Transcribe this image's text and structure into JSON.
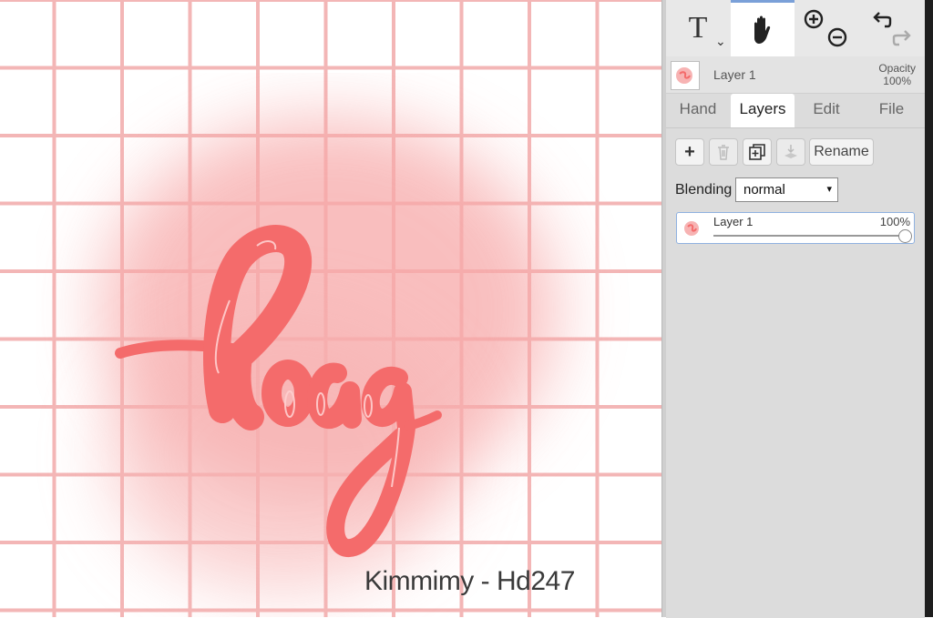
{
  "canvas": {
    "watermark": "Kimmimy - Hd247",
    "grid_color": "#f3b6b6",
    "art_color": "#f46b6b",
    "glow_color": "#f9a7a7"
  },
  "toolbar": {
    "text_tool_glyph": "T",
    "dropdown_glyph": "⌄",
    "icons": [
      "text-tool-icon",
      "hand-tool-icon",
      "zoom-in-icon",
      "zoom-out-icon",
      "undo-icon",
      "redo-icon"
    ],
    "active_tool": "hand"
  },
  "layer_header": {
    "name": "Layer 1",
    "opacity_label": "Opacity",
    "opacity_value": "100%"
  },
  "tabs": [
    {
      "label": "Hand",
      "active": false
    },
    {
      "label": "Layers",
      "active": true
    },
    {
      "label": "Edit",
      "active": false
    },
    {
      "label": "File",
      "active": false
    }
  ],
  "layers_pane": {
    "add_glyph": "+",
    "rename_label": "Rename",
    "blending_label": "Blending",
    "blending_value": "normal",
    "caret": "▾",
    "layers": [
      {
        "name": "Layer 1",
        "opacity": "100%",
        "opacity_fraction": 1.0
      }
    ]
  }
}
